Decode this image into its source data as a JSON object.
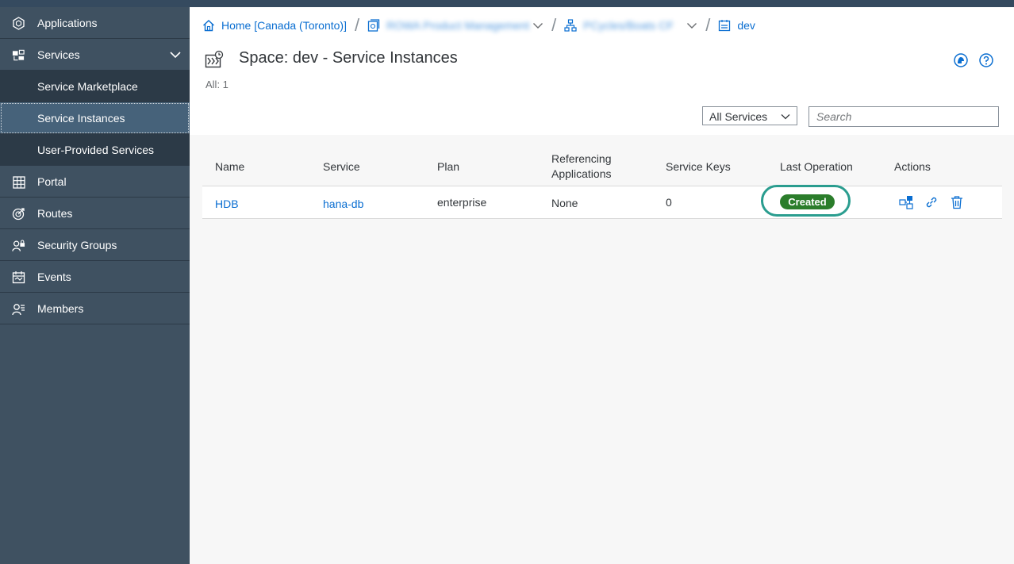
{
  "sidebar": {
    "items": [
      {
        "label": "Applications",
        "icon": "applications-icon"
      },
      {
        "label": "Services",
        "icon": "services-icon"
      },
      {
        "label": "Service Marketplace"
      },
      {
        "label": "Service Instances"
      },
      {
        "label": "User-Provided Services"
      },
      {
        "label": "Portal",
        "icon": "portal-grid-icon"
      },
      {
        "label": "Routes",
        "icon": "routes-icon"
      },
      {
        "label": "Security Groups",
        "icon": "security-groups-icon"
      },
      {
        "label": "Events",
        "icon": "events-icon"
      },
      {
        "label": "Members",
        "icon": "members-icon"
      }
    ]
  },
  "breadcrumb": {
    "home": "Home [Canada (Toronto)]",
    "global_account": "ROWA Product Management",
    "subaccount": "PCycles/Boats CF",
    "space": "dev"
  },
  "header": {
    "title": "Space: dev - Service Instances",
    "count": "All: 1"
  },
  "filter": {
    "selected": "All Services",
    "search_placeholder": "Search"
  },
  "table": {
    "columns": [
      "Name",
      "Service",
      "Plan",
      "Referencing\nApplications",
      "Service Keys",
      "Last Operation",
      "Actions"
    ],
    "rows": [
      {
        "name": "HDB",
        "service": "hana-db",
        "plan": "enterprise",
        "referencing": "None",
        "keys": "0",
        "last_operation": "Created"
      }
    ]
  },
  "colors": {
    "sidebar": "#3f5161",
    "accent": "#0a6ed1",
    "status_success": "#2b7d2b",
    "highlight_ring": "#2a9d8f"
  }
}
